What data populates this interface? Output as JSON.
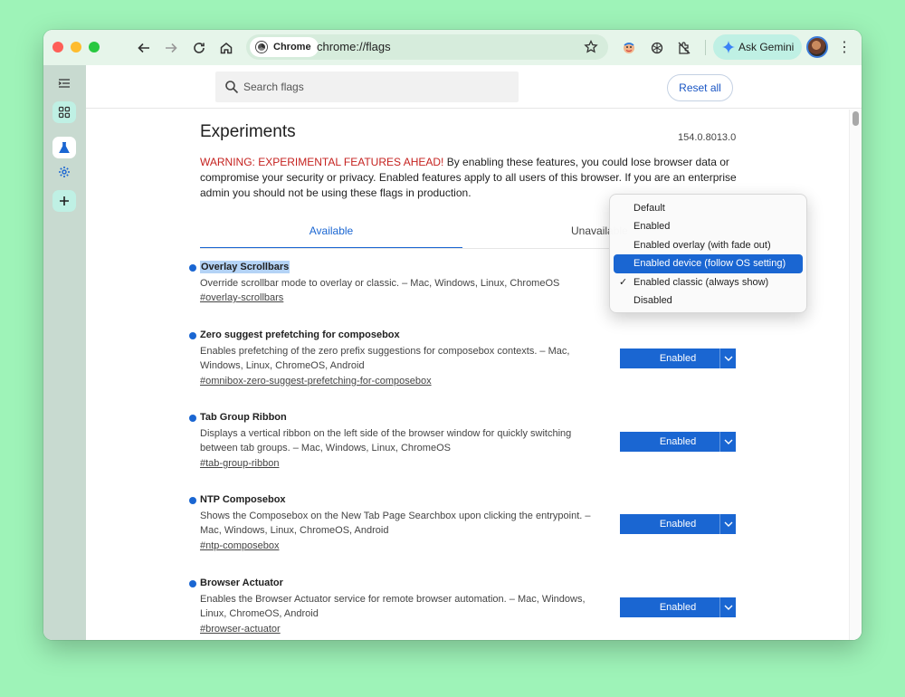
{
  "toolbar": {
    "chip_label": "Chrome",
    "url": "chrome://flags",
    "gemini_label": "Ask Gemini"
  },
  "page": {
    "search_placeholder": "Search flags",
    "reset_label": "Reset all",
    "title": "Experiments",
    "version": "154.0.8013.0",
    "warning_prefix": "WARNING: EXPERIMENTAL FEATURES AHEAD!",
    "warning_text": " By enabling these features, you could lose browser data or compromise your security or privacy. Enabled features apply to all users of this browser. If you are an enterprise admin you should not be using these flags in production.",
    "tab_available": "Available",
    "tab_unavailable": "Unavailable"
  },
  "flags": [
    {
      "name": "Overlay Scrollbars",
      "desc": "Override scrollbar mode to overlay or classic. – Mac, Windows, Linux, ChromeOS",
      "link": "#overlay-scrollbars",
      "value": ""
    },
    {
      "name": "Zero suggest prefetching for composebox",
      "desc": "Enables prefetching of the zero prefix suggestions for composebox contexts. – Mac, Windows, Linux, ChromeOS, Android",
      "link": "#omnibox-zero-suggest-prefetching-for-composebox",
      "value": "Enabled"
    },
    {
      "name": "Tab Group Ribbon",
      "desc": "Displays a vertical ribbon on the left side of the browser window for quickly switching between tab groups. – Mac, Windows, Linux, ChromeOS",
      "link": "#tab-group-ribbon",
      "value": "Enabled"
    },
    {
      "name": "NTP Composebox",
      "desc": "Shows the Composebox on the New Tab Page Searchbox upon clicking the entrypoint. – Mac, Windows, Linux, ChromeOS, Android",
      "link": "#ntp-composebox",
      "value": "Enabled"
    },
    {
      "name": "Browser Actuator",
      "desc": "Enables the Browser Actuator service for remote browser automation. – Mac, Windows, Linux, ChromeOS, Android",
      "link": "#browser-actuator",
      "value": "Enabled"
    }
  ],
  "popup": {
    "options": [
      "Default",
      "Enabled",
      "Enabled overlay (with fade out)",
      "Enabled device (follow OS setting)",
      "Enabled classic (always show)",
      "Disabled"
    ],
    "highlighted": "Enabled device (follow OS setting)",
    "checked": "Enabled classic (always show)",
    "check_glyph": "✓"
  },
  "colors": {
    "accent": "#1a66d2",
    "warning": "#c5221f",
    "background": "#9ef3b8"
  }
}
